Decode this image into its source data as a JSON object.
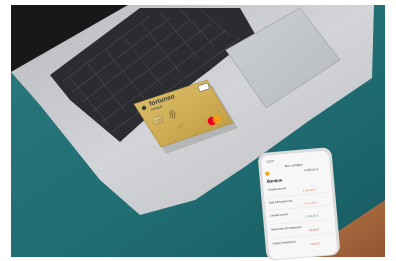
{
  "scene": {
    "colors": {
      "frame": "#ffffff",
      "desk_teal": "#1f6c72",
      "laptop_silver": "#c9cacd",
      "keyboard_dark": "#2b2c2f",
      "wood": "#a96a3f",
      "card_gold": "#cfae56",
      "mastercard_red": "#eb001b",
      "mastercard_orange": "#f79e1b",
      "phone_white": "#f3f3f3",
      "amount_positive": "#3f9a55",
      "amount_negative": "#e2402d"
    }
  },
  "card": {
    "brand": "fortuneo",
    "brand_sub": "banque",
    "tier": "gold",
    "network_icon": "mastercard-icon",
    "chip_icon": "chip-icon",
    "contactless_icon": "contactless-icon"
  },
  "phone": {
    "status_time": "12:54",
    "header_title": "Mes comptes",
    "balance": "4 455,41 €",
    "section_title": "Banque",
    "accounts": [
      {
        "label": "Compte courant",
        "amount": "1 024,43 €",
        "color": "#e8823a"
      },
      {
        "label": "Gold CB Mastercard",
        "amount": "+172,40 €",
        "color": "#e8823a"
      },
      {
        "label": "Compte courant",
        "amount": "2 461,56 €",
        "color": "#3f9a55"
      },
      {
        "label": "World Elite CB Mastercard",
        "amount": "-42,00 €",
        "color": "#e2402d"
      },
      {
        "label": "Fosbury Mastercard",
        "amount": "-79,00 €",
        "color": "#e2402d"
      }
    ]
  }
}
